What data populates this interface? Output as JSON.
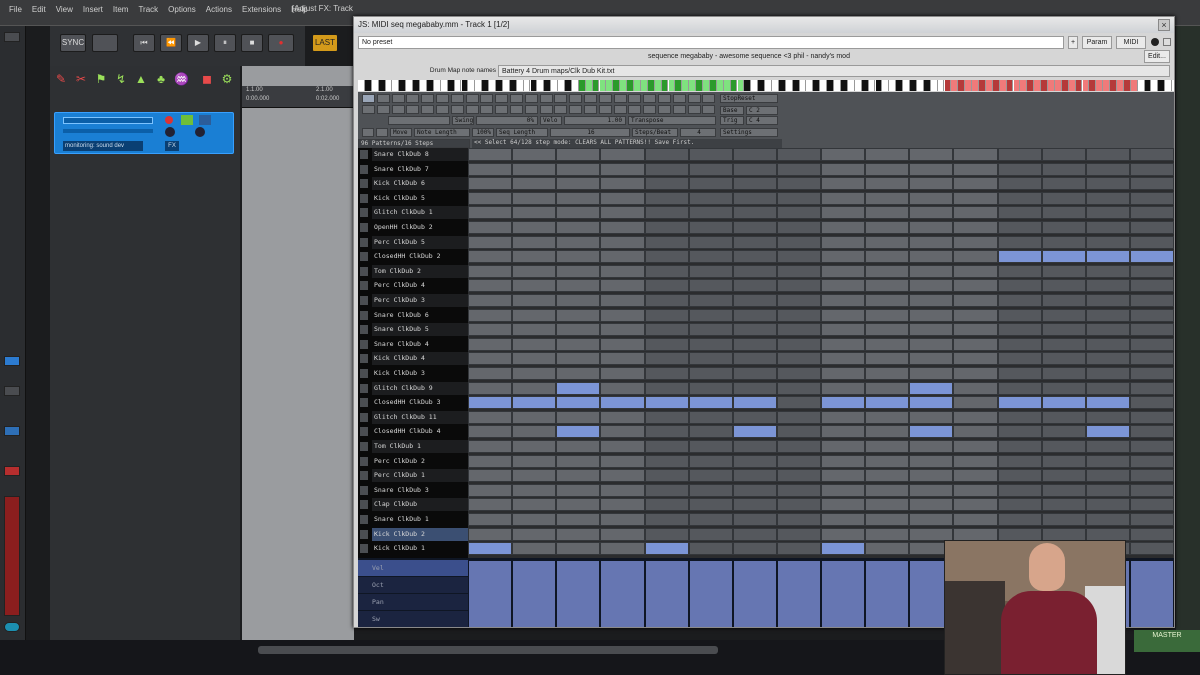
{
  "daw": {
    "menus": [
      "File",
      "Edit",
      "View",
      "Insert",
      "Item",
      "Track",
      "Options",
      "Actions",
      "Extensions",
      "Help"
    ],
    "window_title": "[Adjust FX: Track",
    "transport": {
      "sync_label": "SYNC",
      "rec_mode": "LAST"
    },
    "ruler": {
      "marker1": "1.1.00",
      "marker1_time": "0:00.000",
      "marker2": "2.1.00",
      "marker2_time": "0:02.000"
    },
    "track": {
      "name_field": "monitoring: sound dev",
      "fx_label": "FX"
    },
    "master": {
      "label": "MASTER"
    }
  },
  "plugin": {
    "title": "JS: MIDI seq megababy.mm - Track 1 [1/2]",
    "preset": "No preset",
    "buttons": {
      "plus": "+",
      "param": "Param",
      "midi": "MIDI",
      "edit": "Edit..."
    },
    "description": "sequence megababy - awesome sequence <3 phil - nandy's mod",
    "drum_map_label": "Drum Map note names",
    "drum_map_value": "Battery 4 Drum maps/Clk Dub Kit.txt",
    "controls": {
      "swing_label": "Swing",
      "swing_value": "0%",
      "vel_label": "Velo",
      "vel_value": "1.00",
      "transpose_label": "Transpose",
      "note_length_label": "Note Length",
      "note_length_value": "100%",
      "seq_length_label": "Seq Length",
      "seq_length_value": "16",
      "steps_beat_label": "Steps/Beat",
      "steps_beat_value": "4",
      "base_label": "Base",
      "base_value": "C 2",
      "trig_label": "Trig",
      "trig_value": "C 4",
      "settings_label": "Settings",
      "stop_label": "StopReset",
      "move_label": "Move",
      "patterns": "96 Patterns/16 Steps",
      "hint": "<< Select 64/128 step mode: CLEARS ALL PATTERNS!! Save First."
    },
    "rows": [
      "Snare ClkDub 8",
      "Snare ClkDub 7",
      "Kick ClkDub 6",
      "Kick ClkDub 5",
      "Glitch ClkDub 1",
      "OpenHH ClkDub 2",
      "Perc ClkDub 5",
      "ClosedHH ClkDub 2",
      "Tom ClkDub 2",
      "Perc ClkDub 4",
      "Perc ClkDub 3",
      "Snare ClkDub 6",
      "Snare ClkDub 5",
      "Snare ClkDub 4",
      "Kick ClkDub 4",
      "Kick ClkDub 3",
      "Glitch ClkDub 9",
      "ClosedHH ClkDub 3",
      "Glitch ClkDub 11",
      "ClosedHH ClkDub 4",
      "Tom ClkDub 1",
      "Perc ClkDub 2",
      "Perc ClkDub 1",
      "Snare ClkDub 3",
      "Clap ClkDub",
      "Snare ClkDub 1",
      "Kick ClkDub 2",
      "Kick ClkDub 1"
    ],
    "lanes": [
      "Vel",
      "Oct",
      "Pan",
      "Sw"
    ],
    "active_steps": {
      "7": [
        12,
        13,
        14,
        15
      ],
      "16": [
        2,
        10
      ],
      "17": [
        0,
        1,
        2,
        3,
        4,
        5,
        6,
        8,
        9,
        10,
        12,
        13,
        14
      ],
      "19": [
        2,
        6,
        10,
        14
      ],
      "27": [
        0,
        4,
        8
      ]
    }
  }
}
